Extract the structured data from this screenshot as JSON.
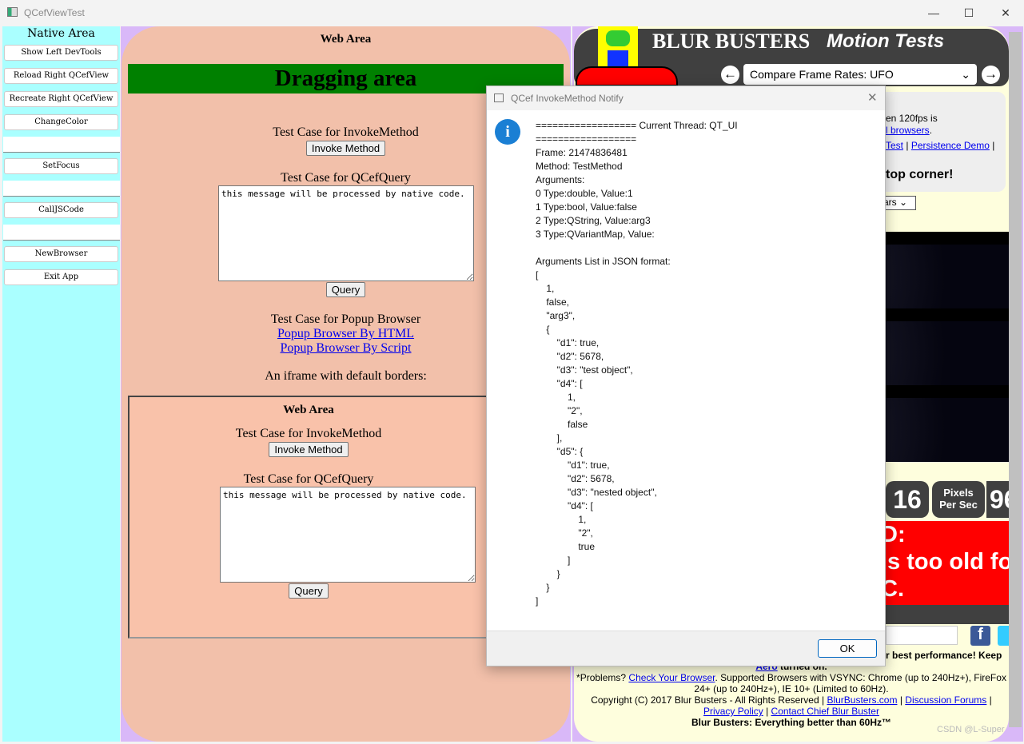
{
  "window": {
    "title": "QCefViewTest",
    "min": "—",
    "max": "☐",
    "close": "✕"
  },
  "native": {
    "header": "Native Area",
    "buttons": [
      "Show Left DevTools",
      "Reload Right QCefView",
      "Recreate Right QCefView",
      "ChangeColor",
      "SetFocus",
      "CallJSCode",
      "NewBrowser",
      "Exit App"
    ]
  },
  "web": {
    "title": "Web Area",
    "dragging": "Dragging area",
    "invoke_label": "Test Case for InvokeMethod",
    "invoke_btn": "Invoke Method",
    "query_label": "Test Case for QCefQuery",
    "query_text": "this message will be processed by native code.",
    "query_btn": "Query",
    "popup_label": "Test Case for Popup Browser",
    "popup_html": "Popup Browser By HTML",
    "popup_script": "Popup Browser By Script",
    "iframe_label": "An iframe with default borders:",
    "iframe": {
      "title": "Web Area",
      "invoke_label": "Test Case for InvokeMethod",
      "invoke_btn": "Invoke Method",
      "query_label": "Test Case for QCefQuery",
      "query_text": "this message will be processed by native code.",
      "query_btn": "Query"
    }
  },
  "blurbusters": {
    "logo": "BLUR BUSTERS",
    "logo2": "Motion Tests",
    "select": "Compare Frame Rates: UFO",
    "info1": "en 120fps is",
    "info2": "l browsers",
    "info_sep": ".",
    "link_test": "Test",
    "link_persist": "Persistence Demo",
    "sep": "|",
    "corner": "top corner!",
    "dropdown": "ars",
    "stat_num": "16",
    "stat_label1": "Pixels",
    "stat_label2": "Per Sec",
    "stat_num2": "96",
    "red1": "D:",
    "red2": "is too old fo",
    "red3": "C.",
    "perf": "r best performance! Keep",
    "aero": "Aero",
    "aero_rest": " turned on.",
    "problems": "*Problems? ",
    "check": "Check Your Browser",
    "supported": ". Supported Browsers with VSYNC: Chrome (up to 240Hz+), FireFox 24+ (up to 240Hz+), IE 10+ (Limited to 60Hz).",
    "copyright": "Copyright (C) 2017 Blur Busters - All Rights Reserved | ",
    "site": "BlurBusters.com",
    "forums": "Discussion Forums",
    "privacy": "Privacy Policy",
    "contact": "Contact Chief Blur Buster",
    "tagline": "Blur Busters: Everything better than 60Hz™",
    "watermark": "CSDN @L-Super"
  },
  "dialog": {
    "title": "QCef InvokeMethod Notify",
    "icon": "info-icon",
    "body": "================== Current Thread: QT_UI\n==================\nFrame: 21474836481\nMethod: TestMethod\nArguments:\n0 Type:double, Value:1\n1 Type:bool, Value:false\n2 Type:QString, Value:arg3\n3 Type:QVariantMap, Value:\n\nArguments List in JSON format:\n[\n    1,\n    false,\n    \"arg3\",\n    {\n        \"d1\": true,\n        \"d2\": 5678,\n        \"d3\": \"test object\",\n        \"d4\": [\n            1,\n            \"2\",\n            false\n        ],\n        \"d5\": {\n            \"d1\": true,\n            \"d2\": 5678,\n            \"d3\": \"nested object\",\n            \"d4\": [\n                1,\n                \"2\",\n                true\n            ]\n        }\n    }\n]",
    "ok": "OK"
  }
}
